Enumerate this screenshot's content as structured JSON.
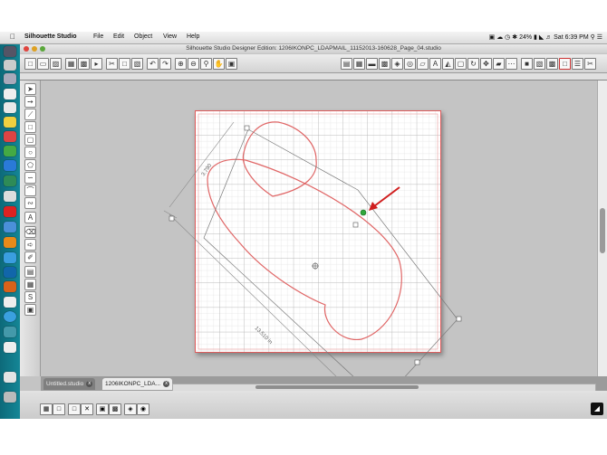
{
  "menubar": {
    "app_name": "Silhouette Studio",
    "items": [
      "File",
      "Edit",
      "Object",
      "View",
      "Help"
    ],
    "status": {
      "battery": "24%",
      "clock": "Sat 6:39 PM"
    }
  },
  "window": {
    "title": "Silhouette Studio Designer Edition: 1206IKONPC_LDAPMAIL_11152013-160628_Page_04.studio"
  },
  "canvas": {
    "dim_top_label": "3.790",
    "dim_long_label": "13.510 in"
  },
  "tabs": [
    {
      "label": "Untitled.studio",
      "active": false
    },
    {
      "label": "1206IKONPC_LDA...",
      "active": true
    }
  ],
  "colors": {
    "dock": "#148696",
    "page_border": "#e05a5a",
    "shape_stroke": "#e06666",
    "arrow": "#d01e1e",
    "rotate_handle": "#2fa83b"
  },
  "icons": {
    "apple": "apple-icon",
    "wifi": "wifi-icon",
    "volume": "volume-icon",
    "search": "spotlight-icon",
    "close_tab": "close-icon"
  }
}
